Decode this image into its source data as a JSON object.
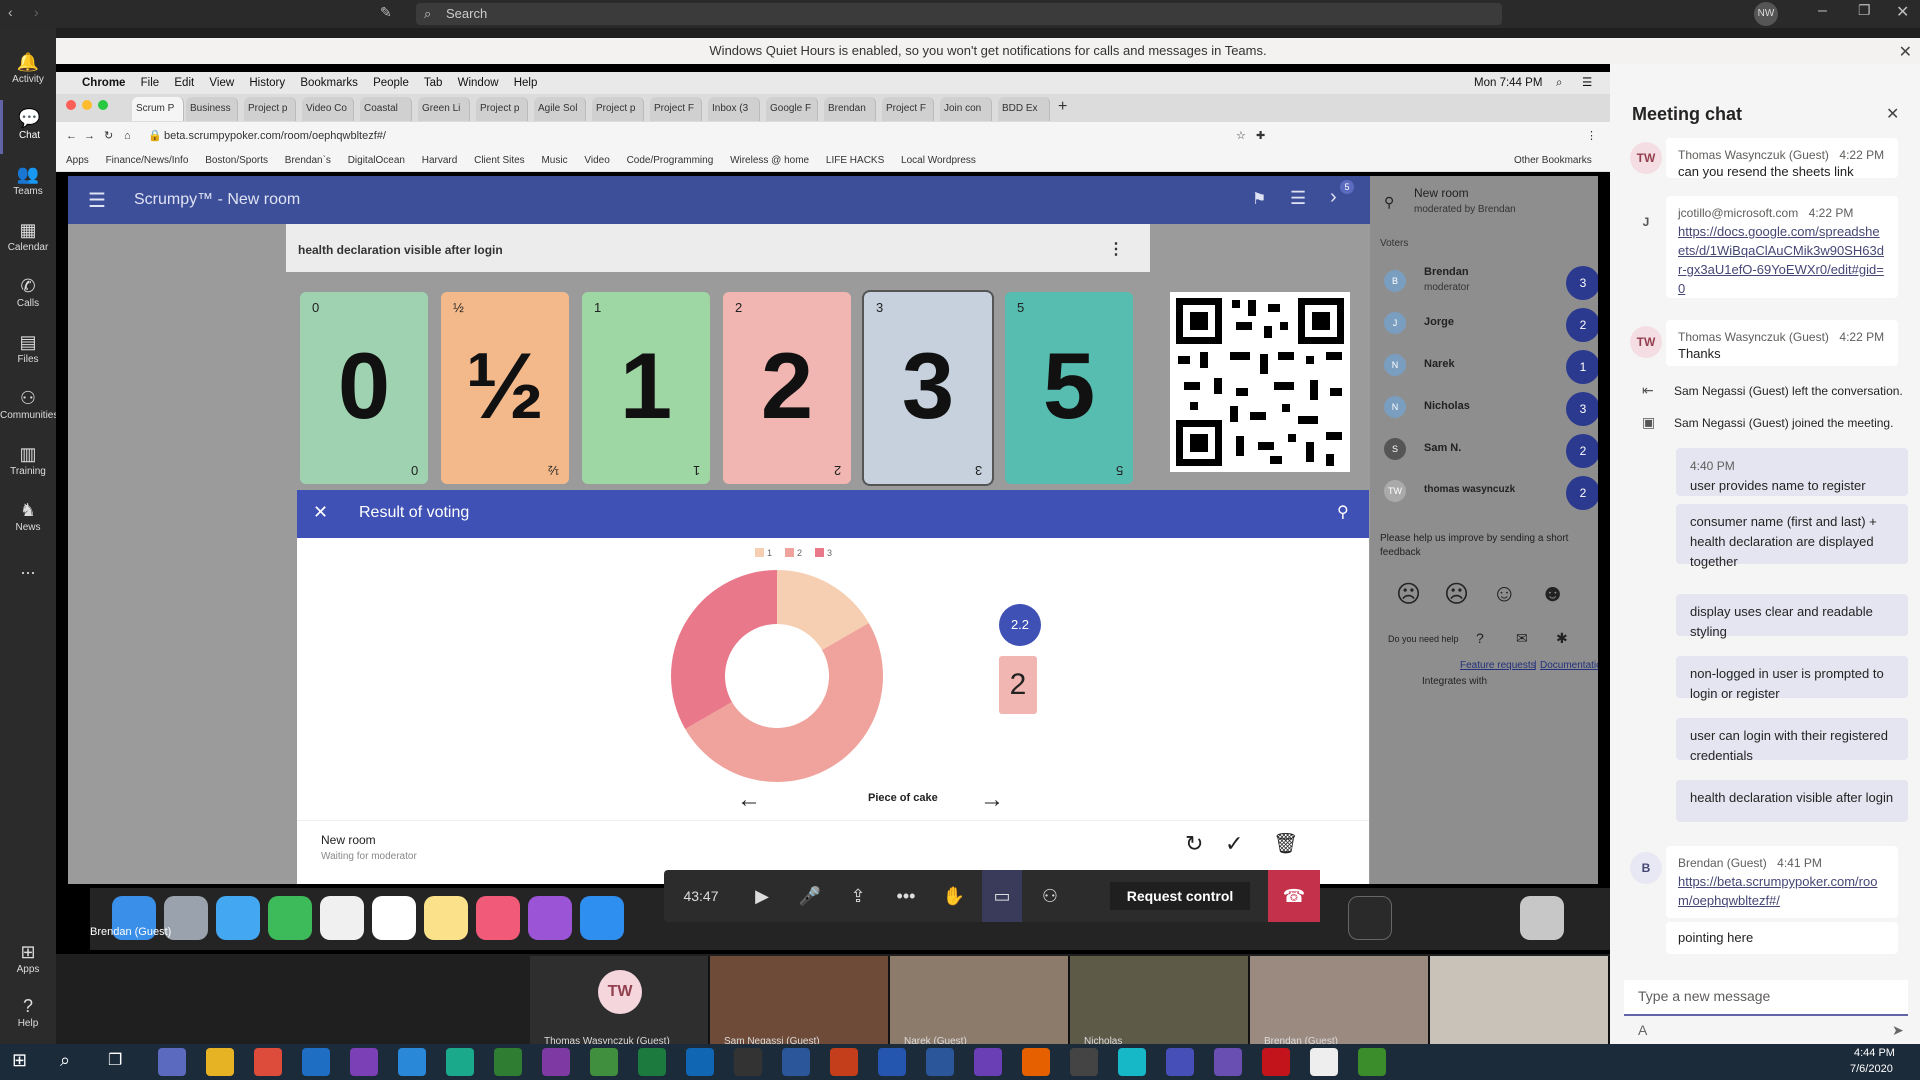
{
  "teams": {
    "search_placeholder": "Search",
    "profile_initials": "NW",
    "rail": [
      {
        "label": "Activity",
        "icon": "bell-icon"
      },
      {
        "label": "Chat",
        "icon": "chat-icon"
      },
      {
        "label": "Teams",
        "icon": "teams-icon"
      },
      {
        "label": "Calendar",
        "icon": "calendar-icon"
      },
      {
        "label": "Calls",
        "icon": "phone-icon"
      },
      {
        "label": "Files",
        "icon": "file-icon"
      },
      {
        "label": "Communities",
        "icon": "communities-icon"
      },
      {
        "label": "Training",
        "icon": "training-icon"
      },
      {
        "label": "News",
        "icon": "news-icon"
      },
      {
        "label": "...",
        "icon": "more-icon"
      },
      {
        "label": "Apps",
        "icon": "apps-icon"
      },
      {
        "label": "Help",
        "icon": "help-icon"
      }
    ],
    "quiet_hours_banner": "Windows Quiet Hours is enabled, so you won't get notifications for calls and messages in Teams."
  },
  "mac": {
    "menu": [
      "Chrome",
      "File",
      "Edit",
      "View",
      "History",
      "Bookmarks",
      "People",
      "Tab",
      "Window",
      "Help"
    ],
    "clock": "Mon 7:44 PM"
  },
  "chrome": {
    "tabs": [
      "Scrum P",
      "Business",
      "Project p",
      "Video Co",
      "Coastal",
      "Green Li",
      "Project p",
      "Agile Sol",
      "Project p",
      "Project F",
      "Inbox (3",
      "Google F",
      "Brendan",
      "Project F",
      "Join con",
      "BDD Ex"
    ],
    "url": "beta.scrumpypoker.com/room/oephqwbltezf#/",
    "bookmarks": [
      "Apps",
      "Finance/News/Info",
      "Boston/Sports",
      "Brendan`s",
      "DigitalOcean",
      "Harvard",
      "Client Sites",
      "Music",
      "Video",
      "Code/Programming",
      "Wireless @ home",
      "LIFE HACKS",
      "Local Wordpress"
    ],
    "other_bookmarks": "Other Bookmarks"
  },
  "scrumpy": {
    "title": "Scrumpy™ - New room",
    "story": "health declaration visible after login",
    "notification_count": "5",
    "cards": [
      {
        "value": "0",
        "bg": "#9fd2b0"
      },
      {
        "value": "½",
        "bg": "#f4b98a"
      },
      {
        "value": "1",
        "bg": "#9ed6a4"
      },
      {
        "value": "2",
        "bg": "#f2b6b2"
      },
      {
        "value": "3",
        "bg": "#c7d1de"
      },
      {
        "value": "5",
        "bg": "#56bdb0"
      }
    ],
    "modal": {
      "title": "Result of voting",
      "legend": [
        "1",
        "2",
        "3"
      ],
      "average": "2.2",
      "card_name": "Piece of cake",
      "winning_card": "2",
      "footer_room": "New room",
      "footer_status": "Waiting for moderator"
    },
    "room": {
      "name": "New room",
      "moderated_by": "moderated by Brendan",
      "voters_label": "Voters",
      "voters": [
        {
          "name": "Brendan",
          "role": "moderator",
          "score": "3",
          "initial": "B"
        },
        {
          "name": "Jorge",
          "role": "",
          "score": "2",
          "initial": "J"
        },
        {
          "name": "Narek",
          "role": "",
          "score": "1",
          "initial": "N"
        },
        {
          "name": "Nicholas",
          "role": "",
          "score": "3",
          "initial": "N"
        },
        {
          "name": "Sam N.",
          "role": "",
          "score": "2",
          "initial": "S"
        },
        {
          "name": "thomas wasyncuzk",
          "role": "",
          "score": "2",
          "initial": "TW"
        }
      ],
      "feedback_prompt": "Please help us improve by sending a short feedback",
      "need_help": "Do you need help",
      "feature_requests": "Feature requests",
      "divider": "|",
      "documentation": "Documentation",
      "integrates_with": "Integrates with"
    }
  },
  "chart_data": {
    "type": "pie",
    "labels": [
      "1",
      "2",
      "3"
    ],
    "values": [
      1,
      3,
      2
    ],
    "colors": [
      "#f6cfb3",
      "#f0a39c",
      "#e8788a"
    ],
    "legend_position": "top"
  },
  "dock_label": "Brendan (Guest)",
  "call": {
    "duration": "43:47",
    "request_control": "Request control"
  },
  "video_strip": {
    "tile_initials": "TW",
    "names": [
      "Thomas Wasynczuk (Guest)",
      "Sam Negassi (Guest)",
      "Narek (Guest)",
      "Nicholas",
      "Brendan (Guest)",
      ""
    ]
  },
  "chat": {
    "title": "Meeting chat",
    "messages": [
      {
        "type": "other",
        "avatar": "TW",
        "sender": "Thomas Wasynczuk (Guest)",
        "time": "4:22 PM",
        "text": "can you resend the sheets link"
      },
      {
        "type": "other",
        "avatar": "J",
        "sender": "jcotillo@microsoft.com",
        "time": "4:22 PM",
        "text": "https://docs.google.com/spreadsheets/d/1WiBqaClAuCMik3w90SH63dr-gx3aU1efO-69YoEWXr0/edit#gid=0"
      },
      {
        "type": "other",
        "avatar": "TW",
        "sender": "Thomas Wasynczuk (Guest)",
        "time": "4:22 PM",
        "text": "Thanks"
      }
    ],
    "events": [
      {
        "text": "Sam Negassi (Guest) left the conversation."
      },
      {
        "text": "Sam Negassi (Guest) joined the meeting."
      }
    ],
    "my_time": "4:40 PM",
    "my_messages": [
      "user provides name to register",
      "consumer name (first and last) + health declaration are displayed together",
      "display uses clear and readable styling",
      "non-logged in user is prompted to login or register",
      "user can login with their registered credentials",
      "health declaration visible after login"
    ],
    "last": {
      "avatar": "B",
      "sender": "Brendan (Guest)",
      "time": "4:41 PM",
      "link": "https://beta.scrumpypoker.com/room/oephqwbltezf#/",
      "text": "pointing here"
    },
    "input_placeholder": "Type a new message"
  },
  "taskbar": {
    "time": "4:44 PM",
    "date": "7/6/2020"
  }
}
